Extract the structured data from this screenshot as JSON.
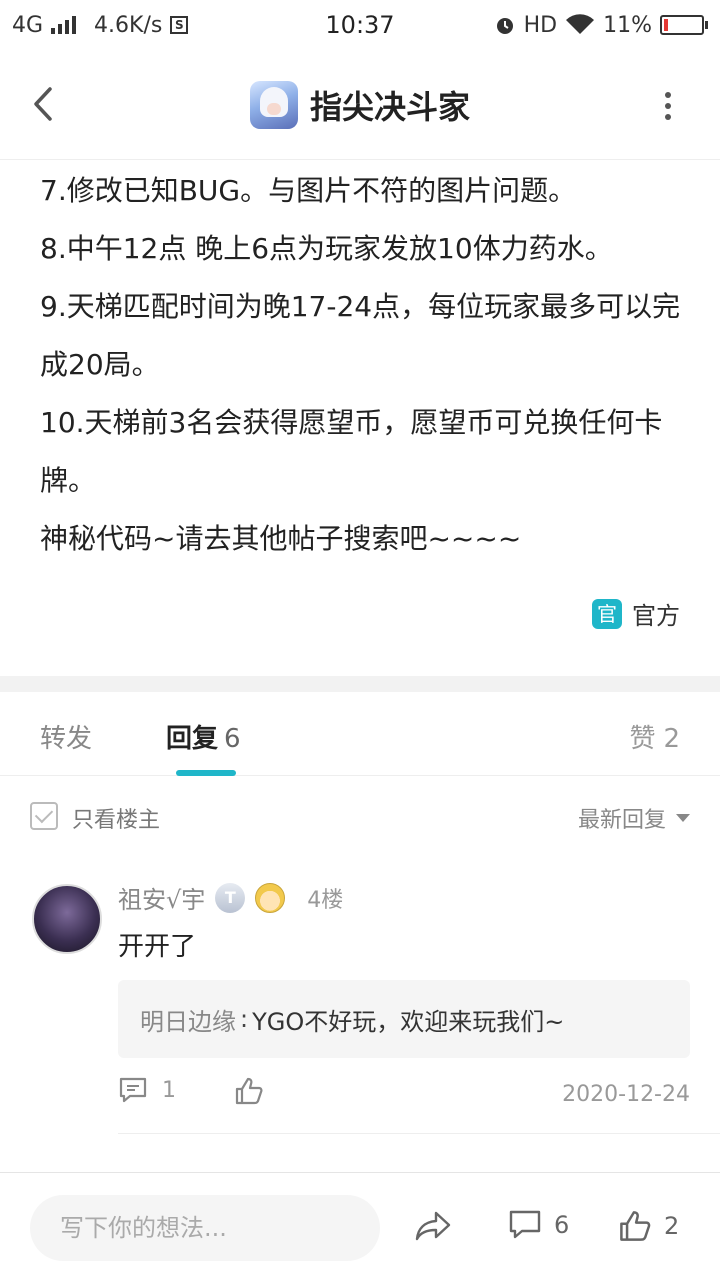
{
  "status_bar": {
    "network": "4G",
    "speed": "4.6K/s",
    "speed_icon": "S",
    "time": "10:37",
    "hd": "HD",
    "battery": "11%",
    "battery_level": 0.11,
    "battery_color": "#e53935"
  },
  "header": {
    "title": "指尖决斗家",
    "back_icon": "chevron-left-icon",
    "more_icon": "more-vertical-icon"
  },
  "article": {
    "lines": [
      "7.修改已知BUG。与图片不符的图片问题。",
      "8.中午12点 晚上6点为玩家发放10体力药水。",
      "9.天梯匹配时间为晚17-24点，每位玩家最多可以完成20局。",
      "10.天梯前3名会获得愿望币，愿望币可兑换任何卡牌。",
      "神秘代码~请去其他帖子搜索吧~~~~"
    ],
    "official_badge": "官",
    "official_label": "官方"
  },
  "tabs": {
    "forward": "转发",
    "reply": "回复",
    "reply_count": "6",
    "like": "赞",
    "like_count": "2",
    "accent": "#1fb6c9"
  },
  "filter": {
    "only_op": "只看楼主",
    "sort": "最新回复"
  },
  "reply": {
    "user": "祖安√宇",
    "level_badge": "T",
    "floor": "4楼",
    "text": "开开了",
    "quote_name": "明日边缘",
    "quote_sep": ":",
    "quote_text": "YGO不好玩，欢迎来玩我们~",
    "comment_count": "1",
    "date": "2020-12-24"
  },
  "bottom_bar": {
    "placeholder": "写下你的想法...",
    "comment_count": "6",
    "like_count": "2"
  }
}
